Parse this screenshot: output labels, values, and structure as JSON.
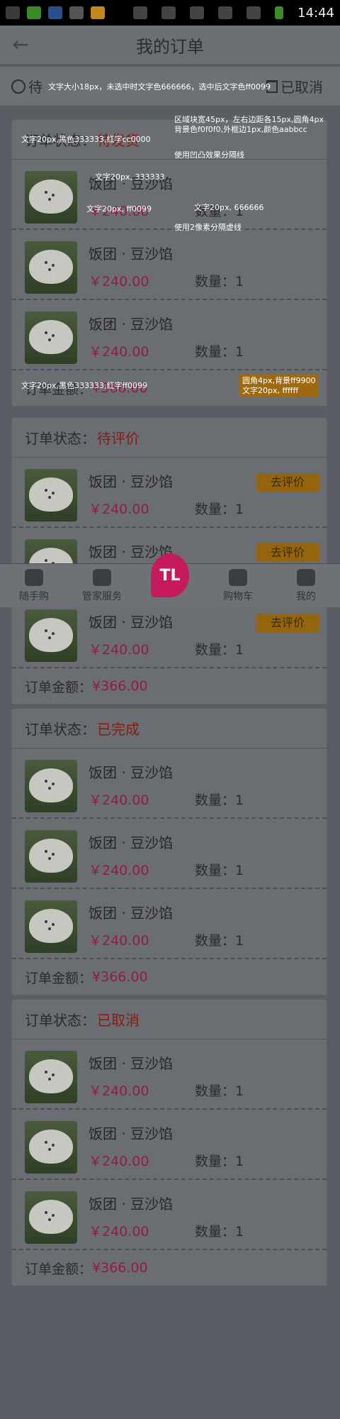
{
  "statusbar": {
    "time": "14:44"
  },
  "header": {
    "title": "我的订单"
  },
  "tabs": [
    {
      "label": "待评价"
    },
    {
      "label": "已取消"
    }
  ],
  "annotations": {
    "tab_note": "文字大小18px，未选中时文字色666666，选中后文字色ff0099",
    "card_note": "区域块宽45px，左右边距各15px,圆角4px\n背景色f0f0f0,外框边1px,颜色aabbcc",
    "head_note": "文字20px,黑色333333,红字cc0000",
    "bevel_note": "使用凹凸效果分隔线",
    "name_note": "文字20px, 333333",
    "price_note": "文字20px, ff0099",
    "qty_note": "文字20px, 666666",
    "dash_note": "使用2像素分隔虚线",
    "total_note": "文字20px,黑色333333,红字ff0099",
    "button_note": "圆角4px,背景ff9900\n文字20px, ffffff"
  },
  "orders": [
    {
      "status_label": "订单状态：",
      "status": "待发货",
      "items": [
        {
          "name": "饭团 · 豆沙馅",
          "price": "￥240.00",
          "qty": "数量：1"
        },
        {
          "name": "饭团 · 豆沙馅",
          "price": "￥240.00",
          "qty": "数量：1"
        },
        {
          "name": "饭团 · 豆沙馅",
          "price": "￥240.00",
          "qty": "数量：1"
        }
      ],
      "total_label": "订单金额：",
      "total": "¥366.00"
    },
    {
      "status_label": "订单状态：",
      "status": "待评价",
      "items": [
        {
          "name": "饭团 · 豆沙馅",
          "price": "￥240.00",
          "qty": "数量：1",
          "button": "去评价"
        },
        {
          "name": "饭团 · 豆沙馅",
          "price": "￥240.00",
          "qty": "数量：1",
          "button": "去评价"
        },
        {
          "name": "饭团 · 豆沙馅",
          "price": "￥240.00",
          "qty": "数量：1",
          "button": "去评价"
        }
      ],
      "total_label": "订单金额：",
      "total": "¥366.00"
    },
    {
      "status_label": "订单状态：",
      "status": "已完成",
      "items": [
        {
          "name": "饭团 · 豆沙馅",
          "price": "￥240.00",
          "qty": "数量：1"
        },
        {
          "name": "饭团 · 豆沙馅",
          "price": "￥240.00",
          "qty": "数量：1"
        },
        {
          "name": "饭团 · 豆沙馅",
          "price": "￥240.00",
          "qty": "数量：1"
        }
      ],
      "total_label": "订单金额：",
      "total": "¥366.00"
    },
    {
      "status_label": "订单状态：",
      "status": "已取消",
      "items": [
        {
          "name": "饭团 · 豆沙馅",
          "price": "￥240.00",
          "qty": "数量：1"
        },
        {
          "name": "饭团 · 豆沙馅",
          "price": "￥240.00",
          "qty": "数量：1"
        },
        {
          "name": "饭团 · 豆沙馅",
          "price": "￥240.00",
          "qty": "数量：1"
        }
      ],
      "total_label": "订单金额：",
      "total": "¥366.00"
    }
  ],
  "bottom_nav": [
    {
      "label": "随手购",
      "icon": "star-icon"
    },
    {
      "label": "管家服务",
      "icon": "wrench-icon"
    },
    {
      "label": "",
      "icon": "logo-icon"
    },
    {
      "label": "购物车",
      "icon": "cart-icon"
    },
    {
      "label": "我的",
      "icon": "user-icon"
    }
  ]
}
